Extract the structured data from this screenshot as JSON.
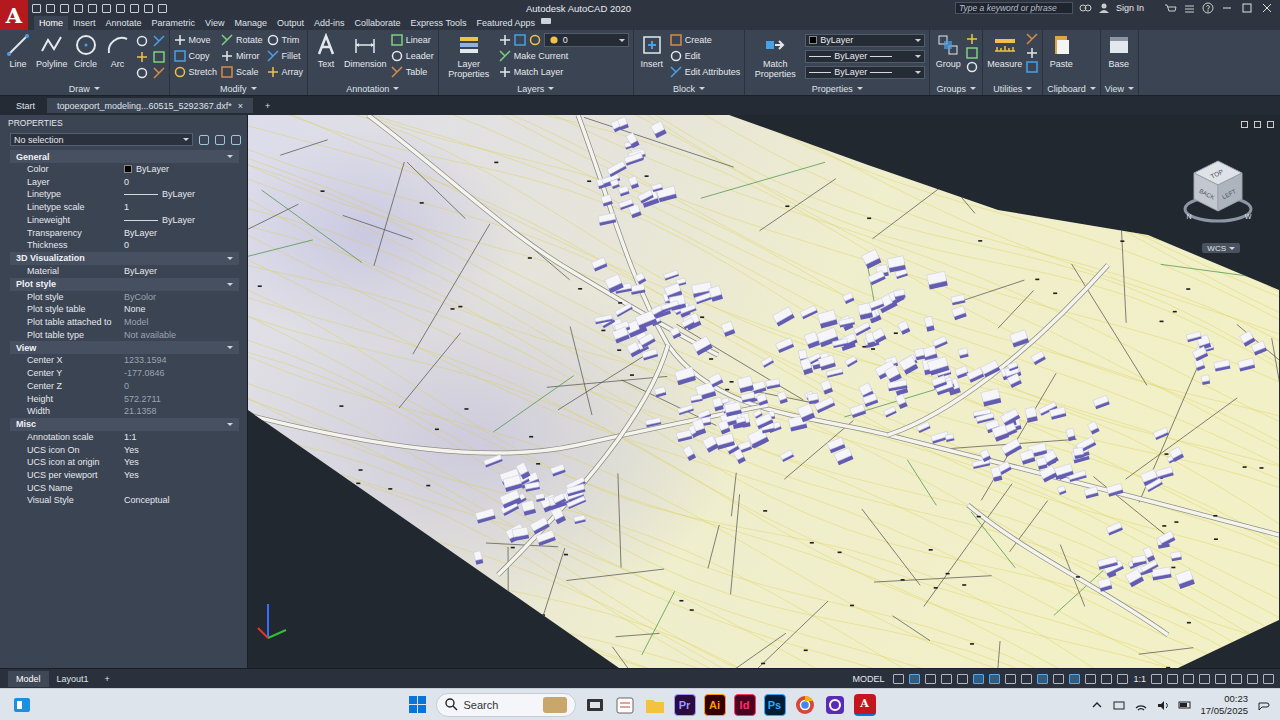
{
  "titlebar": {
    "logo": "A",
    "title": "Autodesk AutoCAD 2020",
    "search_placeholder": "Type a keyword or phrase",
    "sign_in": "Sign In"
  },
  "ribbon_tabs": [
    {
      "label": "Home",
      "selected": true
    },
    {
      "label": "Insert",
      "selected": false
    },
    {
      "label": "Annotate",
      "selected": false
    },
    {
      "label": "Parametric",
      "selected": false
    },
    {
      "label": "View",
      "selected": false
    },
    {
      "label": "Manage",
      "selected": false
    },
    {
      "label": "Output",
      "selected": false
    },
    {
      "label": "Add-ins",
      "selected": false
    },
    {
      "label": "Collaborate",
      "selected": false
    },
    {
      "label": "Express Tools",
      "selected": false
    },
    {
      "label": "Featured Apps",
      "selected": false
    }
  ],
  "ribbon_groups": [
    {
      "title": "Draw",
      "large": [
        "Line",
        "Polyline",
        "Circle",
        "Arc"
      ],
      "small": [],
      "dropdowns": []
    },
    {
      "title": "Modify",
      "large": [],
      "small": [
        "Move",
        "Copy",
        "Stretch",
        "Rotate",
        "Mirror",
        "Scale",
        "Trim",
        "Fillet",
        "Array"
      ],
      "dropdowns": []
    },
    {
      "title": "Annotation",
      "large": [
        "Text",
        "Dimension"
      ],
      "small": [
        "Linear",
        "Leader",
        "Table"
      ],
      "dropdowns": []
    },
    {
      "title": "Layers",
      "large": [
        "Layer Properties"
      ],
      "small": [
        "Make Current",
        "Match Layer"
      ],
      "dropdowns": [
        {
          "value": "0",
          "kind": "layer"
        }
      ]
    },
    {
      "title": "Block",
      "large": [
        "Insert"
      ],
      "small": [
        "Create",
        "Edit",
        "Edit Attributes"
      ],
      "dropdowns": []
    },
    {
      "title": "Properties",
      "large": [
        "Match Properties"
      ],
      "small": [],
      "dropdowns": [
        {
          "value": "ByLayer",
          "kind": "color"
        },
        {
          "value": "ByLayer",
          "kind": "line"
        },
        {
          "value": "ByLayer",
          "kind": "line"
        }
      ]
    },
    {
      "title": "Groups",
      "large": [
        "Group"
      ],
      "small": [],
      "dropdowns": []
    },
    {
      "title": "Utilities",
      "large": [
        "Measure"
      ],
      "small": [],
      "dropdowns": []
    },
    {
      "title": "Clipboard",
      "large": [
        "Paste"
      ],
      "small": [],
      "dropdowns": []
    },
    {
      "title": "View",
      "large": [
        "Base"
      ],
      "small": [],
      "dropdowns": []
    }
  ],
  "file_tabs": [
    {
      "label": "Start",
      "selected": false
    },
    {
      "label": "topoexport_modeling...60515_5292367.dxf*",
      "selected": true,
      "close": "×"
    }
  ],
  "new_file_tab": "+",
  "properties_palette": {
    "title": "PROPERTIES",
    "selection": "No selection",
    "sections": [
      {
        "title": "General",
        "expanded": true,
        "rows": [
          {
            "label": "Color",
            "value": "ByLayer",
            "kind": "swatch",
            "disabled": false
          },
          {
            "label": "Layer",
            "value": "0",
            "kind": "text",
            "disabled": false
          },
          {
            "label": "Linetype",
            "value": "ByLayer",
            "kind": "line",
            "disabled": false
          },
          {
            "label": "Linetype scale",
            "value": "1",
            "kind": "text",
            "disabled": false
          },
          {
            "label": "Lineweight",
            "value": "ByLayer",
            "kind": "line",
            "disabled": false
          },
          {
            "label": "Transparency",
            "value": "ByLayer",
            "kind": "text",
            "disabled": false
          },
          {
            "label": "Thickness",
            "value": "0",
            "kind": "text",
            "disabled": false
          }
        ]
      },
      {
        "title": "3D Visualization",
        "expanded": true,
        "rows": [
          {
            "label": "Material",
            "value": "ByLayer",
            "kind": "text",
            "disabled": false
          }
        ]
      },
      {
        "title": "Plot style",
        "expanded": true,
        "rows": [
          {
            "label": "Plot style",
            "value": "ByColor",
            "kind": "text",
            "disabled": true
          },
          {
            "label": "Plot style table",
            "value": "None",
            "kind": "text",
            "disabled": false
          },
          {
            "label": "Plot table attached to",
            "value": "Model",
            "kind": "text",
            "disabled": true
          },
          {
            "label": "Plot table type",
            "value": "Not available",
            "kind": "text",
            "disabled": true
          }
        ]
      },
      {
        "title": "View",
        "expanded": true,
        "rows": [
          {
            "label": "Center X",
            "value": "1233.1594",
            "kind": "text",
            "disabled": true
          },
          {
            "label": "Center Y",
            "value": "-177.0846",
            "kind": "text",
            "disabled": true
          },
          {
            "label": "Center Z",
            "value": "0",
            "kind": "text",
            "disabled": true
          },
          {
            "label": "Height",
            "value": "572.2711",
            "kind": "text",
            "disabled": true
          },
          {
            "label": "Width",
            "value": "21.1358",
            "kind": "text",
            "disabled": true
          }
        ]
      },
      {
        "title": "Misc",
        "expanded": true,
        "rows": [
          {
            "label": "Annotation scale",
            "value": "1:1",
            "kind": "text",
            "disabled": false
          },
          {
            "label": "UCS icon On",
            "value": "Yes",
            "kind": "text",
            "disabled": false
          },
          {
            "label": "UCS icon at origin",
            "value": "Yes",
            "kind": "text",
            "disabled": false
          },
          {
            "label": "UCS per viewport",
            "value": "Yes",
            "kind": "text",
            "disabled": false
          },
          {
            "label": "UCS Name",
            "value": "",
            "kind": "text",
            "disabled": false
          },
          {
            "label": "Visual Style",
            "value": "Conceptual",
            "kind": "text",
            "disabled": false
          }
        ]
      }
    ]
  },
  "viewport": {
    "viewcube": {
      "top": "TOP",
      "left_face": "BACK",
      "right_face": "LEFT",
      "compass": [
        "N",
        "W"
      ]
    },
    "wcs": "WCS"
  },
  "layout_tabs": [
    {
      "label": "Model",
      "selected": true
    },
    {
      "label": "Layout1",
      "selected": false
    }
  ],
  "new_layout": "+",
  "status_bar": {
    "mode": "MODEL",
    "scale": "1:1"
  },
  "taskbar": {
    "search": "Search",
    "apps": [
      {
        "label": "Pr",
        "color": "#9999ff"
      },
      {
        "label": "Ai",
        "color": "#ff9a00"
      },
      {
        "label": "Id",
        "color": "#ff3366"
      },
      {
        "label": "Ps",
        "color": "#31a8ff"
      }
    ],
    "autocad": "A",
    "time": "00:23",
    "date": "17/05/2025"
  }
}
